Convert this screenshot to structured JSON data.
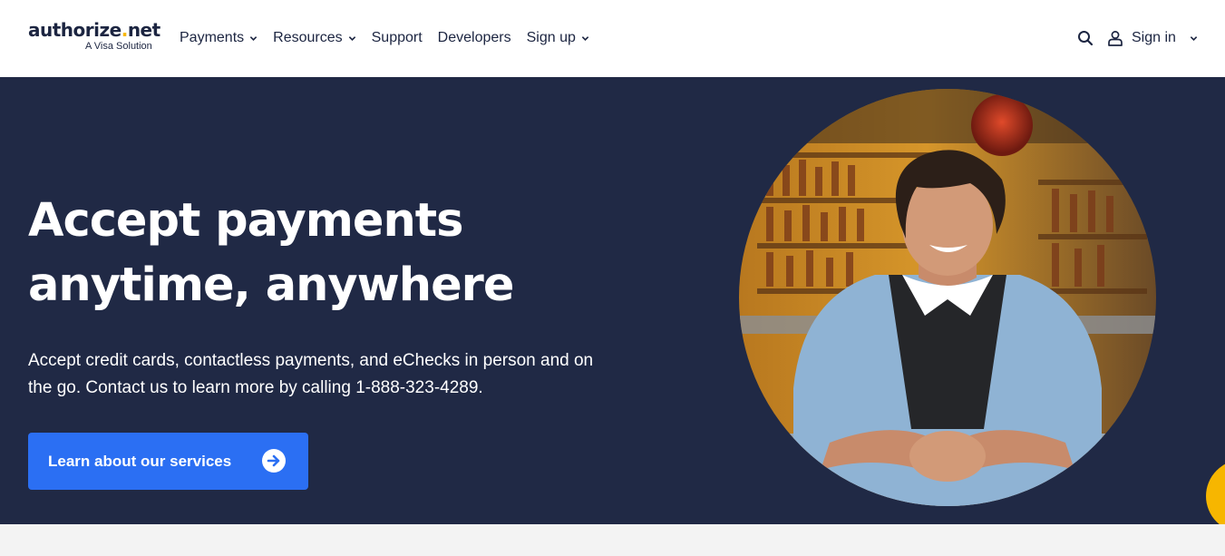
{
  "brand": {
    "name_main": "authorize",
    "name_dot": ".",
    "name_tld": "net",
    "tagline": "A Visa Solution"
  },
  "nav": {
    "items": [
      {
        "label": "Payments",
        "has_dropdown": true
      },
      {
        "label": "Resources",
        "has_dropdown": true
      },
      {
        "label": "Support",
        "has_dropdown": false
      },
      {
        "label": "Developers",
        "has_dropdown": false
      },
      {
        "label": "Sign up",
        "has_dropdown": true
      }
    ],
    "search_icon": "search-icon",
    "user_icon": "user-icon",
    "signin_label": "Sign in"
  },
  "hero": {
    "headline_line1": "Accept payments",
    "headline_line2": "anytime, anywhere",
    "subtext": "Accept credit cards, contactless payments, and eChecks in person and on the go. Contact us to learn more by calling 1-888-323-4289.",
    "cta_label": "Learn about our services",
    "cta_icon": "arrow-right-circle-icon",
    "image_icon": "smiling-bartender-photo"
  },
  "colors": {
    "navy": "#202945",
    "text_dark": "#1c2541",
    "accent_blue": "#2b6ff3",
    "accent_yellow": "#f7b600",
    "page_bg": "#f3f3f3"
  }
}
